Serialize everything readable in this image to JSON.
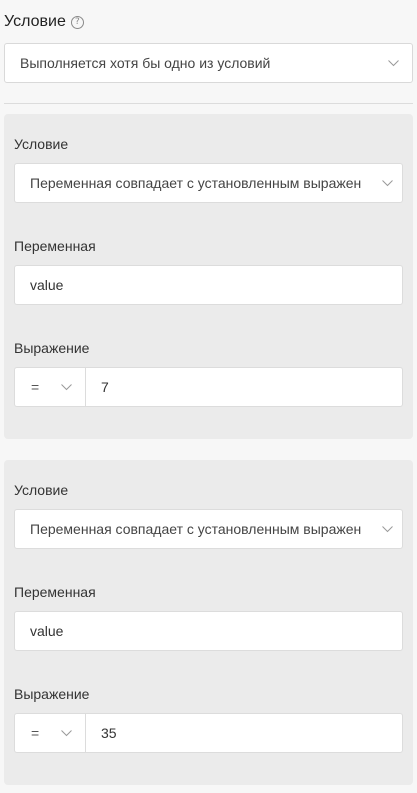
{
  "header": {
    "title": "Условие",
    "help_icon": "?"
  },
  "top_select": {
    "value": "Выполняется хотя бы одно из условий"
  },
  "conditions": [
    {
      "condition_label": "Условие",
      "condition_value": "Переменная совпадает с установленным выражен",
      "variable_label": "Переменная",
      "variable_value": "value",
      "expression_label": "Выражение",
      "operator": "=",
      "expression_value": "7"
    },
    {
      "condition_label": "Условие",
      "condition_value": "Переменная совпадает с установленным выражен",
      "variable_label": "Переменная",
      "variable_value": "value",
      "expression_label": "Выражение",
      "operator": "=",
      "expression_value": "35"
    }
  ],
  "colors": {
    "card_bg": "#ebebeb",
    "page_bg": "#f7f7f7",
    "border": "#d9d9d9"
  }
}
